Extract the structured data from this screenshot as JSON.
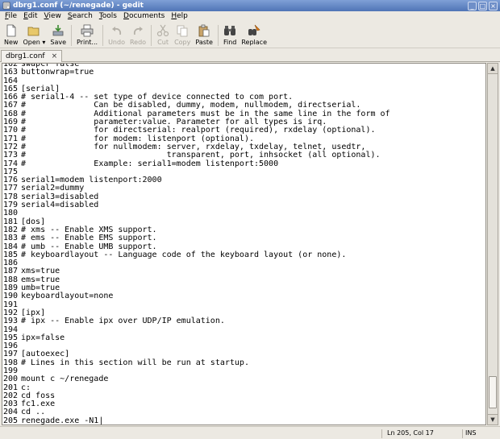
{
  "window": {
    "title": "dbrg1.conf (~/renegade) - gedit",
    "controls": [
      "_",
      "□",
      "×"
    ]
  },
  "menu": [
    {
      "underline": "F",
      "rest": "ile"
    },
    {
      "underline": "E",
      "rest": "dit"
    },
    {
      "underline": "V",
      "rest": "iew"
    },
    {
      "underline": "S",
      "rest": "earch"
    },
    {
      "underline": "T",
      "rest": "ools"
    },
    {
      "underline": "D",
      "rest": "ocuments"
    },
    {
      "underline": "H",
      "rest": "elp"
    }
  ],
  "toolbar": {
    "new": "New",
    "open": "Open",
    "open_arrow": "▾",
    "save": "Save",
    "print": "Print...",
    "undo": "Undo",
    "redo": "Redo",
    "cut": "Cut",
    "copy": "Copy",
    "paste": "Paste",
    "find": "Find",
    "replace": "Replace"
  },
  "tab": {
    "label": "dbrg1.conf",
    "close": "×"
  },
  "editor": {
    "lines": [
      {
        "n": "162",
        "t": "swapcr false"
      },
      {
        "n": "163",
        "t": "buttonwrap=true"
      },
      {
        "n": "164",
        "t": ""
      },
      {
        "n": "165",
        "t": "[serial]"
      },
      {
        "n": "166",
        "t": "# serial1-4 -- set type of device connected to com port."
      },
      {
        "n": "167",
        "t": "#              Can be disabled, dummy, modem, nullmodem, directserial."
      },
      {
        "n": "168",
        "t": "#              Additional parameters must be in the same line in the form of"
      },
      {
        "n": "169",
        "t": "#              parameter:value. Parameter for all types is irq."
      },
      {
        "n": "170",
        "t": "#              for directserial: realport (required), rxdelay (optional)."
      },
      {
        "n": "171",
        "t": "#              for modem: listenport (optional)."
      },
      {
        "n": "172",
        "t": "#              for nullmodem: server, rxdelay, txdelay, telnet, usedtr,"
      },
      {
        "n": "173",
        "t": "#                             transparent, port, inhsocket (all optional)."
      },
      {
        "n": "174",
        "t": "#              Example: serial1=modem listenport:5000"
      },
      {
        "n": "175",
        "t": ""
      },
      {
        "n": "176",
        "t": "serial1=modem listenport:2000"
      },
      {
        "n": "177",
        "t": "serial2=dummy"
      },
      {
        "n": "178",
        "t": "serial3=disabled"
      },
      {
        "n": "179",
        "t": "serial4=disabled"
      },
      {
        "n": "180",
        "t": ""
      },
      {
        "n": "181",
        "t": "[dos]"
      },
      {
        "n": "182",
        "t": "# xms -- Enable XMS support."
      },
      {
        "n": "183",
        "t": "# ems -- Enable EMS support."
      },
      {
        "n": "184",
        "t": "# umb -- Enable UMB support."
      },
      {
        "n": "185",
        "t": "# keyboardlayout -- Language code of the keyboard layout (or none)."
      },
      {
        "n": "186",
        "t": ""
      },
      {
        "n": "187",
        "t": "xms=true"
      },
      {
        "n": "188",
        "t": "ems=true"
      },
      {
        "n": "189",
        "t": "umb=true"
      },
      {
        "n": "190",
        "t": "keyboardlayout=none"
      },
      {
        "n": "191",
        "t": ""
      },
      {
        "n": "192",
        "t": "[ipx]"
      },
      {
        "n": "193",
        "t": "# ipx -- Enable ipx over UDP/IP emulation."
      },
      {
        "n": "194",
        "t": ""
      },
      {
        "n": "195",
        "t": "ipx=false"
      },
      {
        "n": "196",
        "t": ""
      },
      {
        "n": "197",
        "t": "[autoexec]"
      },
      {
        "n": "198",
        "t": "# Lines in this section will be run at startup."
      },
      {
        "n": "199",
        "t": ""
      },
      {
        "n": "200",
        "t": "mount c ~/renegade"
      },
      {
        "n": "201",
        "t": "c:"
      },
      {
        "n": "202",
        "t": "cd foss"
      },
      {
        "n": "203",
        "t": "fc1.exe"
      },
      {
        "n": "204",
        "t": "cd .."
      },
      {
        "n": "205",
        "t": "renegade.exe -N1|"
      }
    ]
  },
  "scrollbar": {
    "up": "▲",
    "down": "▼",
    "position_fraction": 0.95
  },
  "status": {
    "position": "Ln 205, Col 17",
    "mode": "INS"
  }
}
